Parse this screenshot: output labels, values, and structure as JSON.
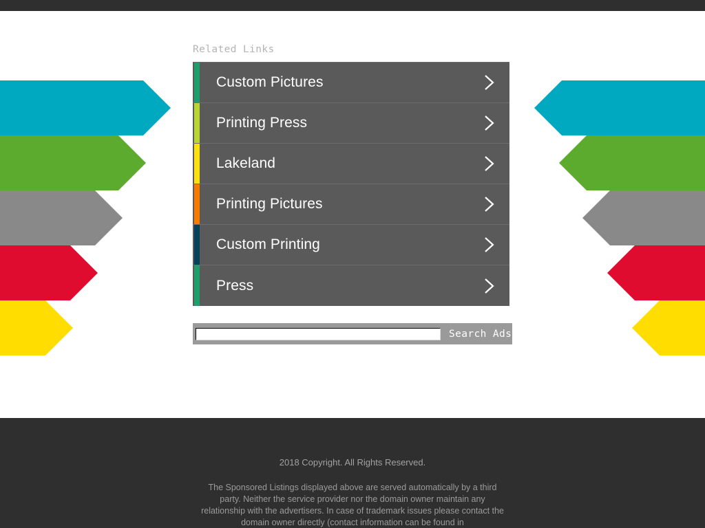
{
  "page": {
    "topbar_color": "#2f2f2f",
    "background_color": "#ffffff"
  },
  "related": {
    "heading": "Related Links",
    "panel_color": "#5a5a5a",
    "items": [
      {
        "label": "Custom Pictures",
        "accent": "#1f9e6c",
        "chevron": "chevron-right-icon"
      },
      {
        "label": "Printing Press",
        "accent": "#b9d435",
        "chevron": "chevron-right-icon"
      },
      {
        "label": "Lakeland",
        "accent": "#fbe113",
        "chevron": "chevron-right-icon"
      },
      {
        "label": "Printing Pictures",
        "accent": "#f57c00",
        "chevron": "chevron-right-icon"
      },
      {
        "label": "Custom Printing",
        "accent": "#08415a",
        "chevron": "chevron-right-icon"
      },
      {
        "label": "Press",
        "accent": "#1f9e6c",
        "chevron": "chevron-right-icon"
      }
    ]
  },
  "search": {
    "value": "",
    "placeholder": "",
    "button_label": "Search Ads"
  },
  "decor": {
    "left_bands": [
      {
        "color": "#00a8c0"
      },
      {
        "color": "#5dab2e"
      },
      {
        "color": "#898989"
      },
      {
        "color": "#e00c2f"
      },
      {
        "color": "#ffdd00"
      }
    ],
    "right_bands": [
      {
        "color": "#00a8c0"
      },
      {
        "color": "#5dab2e"
      },
      {
        "color": "#898989"
      },
      {
        "color": "#e00c2f"
      },
      {
        "color": "#ffdd00"
      }
    ]
  },
  "footer": {
    "copyright": "2018 Copyright. All Rights Reserved.",
    "disclaimer": "The Sponsored Listings displayed above are served automatically by a third party. Neither the service provider nor the domain owner maintain any relationship with the advertisers. In case of trademark issues please contact the domain owner directly (contact information can be found in"
  }
}
